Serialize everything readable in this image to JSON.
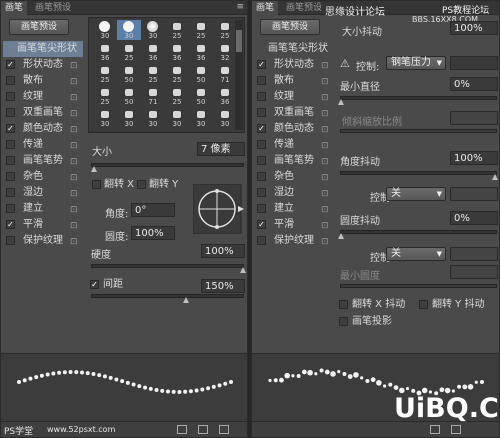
{
  "left": {
    "tabs": [
      "画笔",
      "画笔预设"
    ],
    "preset_button": "画笔预设",
    "list_header": "画笔笔尖形状",
    "options": [
      {
        "label": "形状动态",
        "checked": true
      },
      {
        "label": "散布",
        "checked": false
      },
      {
        "label": "纹理",
        "checked": false
      },
      {
        "label": "双重画笔",
        "checked": false
      },
      {
        "label": "颜色动态",
        "checked": true
      },
      {
        "label": "传递",
        "checked": false
      },
      {
        "label": "画笔笔势",
        "checked": false
      },
      {
        "label": "杂色",
        "checked": false
      },
      {
        "label": "湿边",
        "checked": false
      },
      {
        "label": "建立",
        "checked": false
      },
      {
        "label": "平滑",
        "checked": true
      },
      {
        "label": "保护纹理",
        "checked": false
      }
    ],
    "brush_sizes": [
      [
        "30",
        "30",
        "30",
        "25",
        "25",
        "25"
      ],
      [
        "36",
        "25",
        "36",
        "36",
        "36",
        "32"
      ],
      [
        "25",
        "50",
        "25",
        "25",
        "50",
        "71"
      ],
      [
        "25",
        "50",
        "71",
        "25",
        "50",
        "36"
      ],
      [
        "30",
        "30",
        "30",
        "30",
        "30",
        "30"
      ]
    ],
    "selected_brush": "30",
    "size_label": "大小",
    "size_value": "7 像素",
    "flip_x": "翻转 X",
    "flip_y": "翻转 Y",
    "angle_label": "角度:",
    "angle_value": "0°",
    "roundness_label": "圆度:",
    "roundness_value": "100%",
    "hardness_label": "硬度",
    "hardness_value": "100%",
    "spacing_label": "间距",
    "spacing_value": "150%",
    "spacing_checked": true,
    "watermark_left": "PS学堂",
    "watermark_right": "www.52psxt.com"
  },
  "right": {
    "tabs": [
      "画笔",
      "画笔预设"
    ],
    "site_watermark": "思缘设计论坛",
    "site_watermark2": "PS教程论坛",
    "site_url": "BBS.16XX8.COM",
    "size_jitter_label": "大小抖动",
    "size_jitter_value": "100%",
    "preset_button": "画笔预设",
    "list_header": "画笔笔尖形状",
    "options": [
      {
        "label": "形状动态",
        "checked": true
      },
      {
        "label": "散布",
        "checked": false
      },
      {
        "label": "纹理",
        "checked": false
      },
      {
        "label": "双重画笔",
        "checked": false
      },
      {
        "label": "颜色动态",
        "checked": true
      },
      {
        "label": "传递",
        "checked": false
      },
      {
        "label": "画笔笔势",
        "checked": false
      },
      {
        "label": "杂色",
        "checked": false
      },
      {
        "label": "湿边",
        "checked": false
      },
      {
        "label": "建立",
        "checked": false
      },
      {
        "label": "平滑",
        "checked": true
      },
      {
        "label": "保护纹理",
        "checked": false
      }
    ],
    "control_label": "控制:",
    "control_value_1": "钢笔压力",
    "min_diameter_label": "最小直径",
    "min_diameter_value": "0%",
    "tilt_scale_label": "倾斜缩放比例",
    "angle_jitter_label": "角度抖动",
    "angle_jitter_value": "100%",
    "control_value_2": "关",
    "roundness_jitter_label": "圆度抖动",
    "roundness_jitter_value": "0%",
    "control_value_3": "关",
    "min_roundness_label": "最小圆度",
    "flip_x_jitter": "翻转 X 抖动",
    "flip_y_jitter": "翻转 Y 抖动",
    "brush_projection": "画笔投影",
    "watermark_logo": "UiBQ.CoM"
  }
}
